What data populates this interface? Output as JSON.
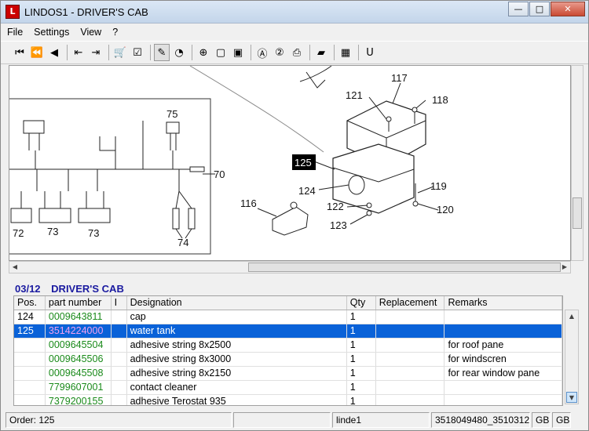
{
  "window": {
    "title": "LINDOS1 - DRIVER'S CAB",
    "app_icon_label": "L",
    "minimize": "—",
    "maximize": "□",
    "close": "✕"
  },
  "menu": [
    "File",
    "Settings",
    "View",
    "?"
  ],
  "toolbar": [
    {
      "name": "first-icon",
      "glyph": "⏮"
    },
    {
      "name": "previous-fast-icon",
      "glyph": "⏪"
    },
    {
      "name": "previous-icon",
      "glyph": "◀"
    },
    {
      "name": "sep"
    },
    {
      "name": "back-page-icon",
      "glyph": "⇤"
    },
    {
      "name": "forward-page-icon",
      "glyph": "⇥"
    },
    {
      "name": "sep"
    },
    {
      "name": "cart-icon",
      "glyph": "🛒"
    },
    {
      "name": "checklist-icon",
      "glyph": "☑"
    },
    {
      "name": "sep"
    },
    {
      "name": "link-tool-icon",
      "glyph": "✎",
      "pressed": true
    },
    {
      "name": "globe-icon",
      "glyph": "◔"
    },
    {
      "name": "sep"
    },
    {
      "name": "zoom-in-icon",
      "glyph": "⊕"
    },
    {
      "name": "page-icon",
      "glyph": "▢"
    },
    {
      "name": "page-view-icon",
      "glyph": "▣"
    },
    {
      "name": "sep"
    },
    {
      "name": "find-a-icon",
      "glyph": "Ⓐ"
    },
    {
      "name": "find-2-icon",
      "glyph": "②"
    },
    {
      "name": "print-icon",
      "glyph": "⎙"
    },
    {
      "name": "sep"
    },
    {
      "name": "book-icon",
      "glyph": "▰"
    },
    {
      "name": "sep"
    },
    {
      "name": "grid-icon",
      "glyph": "▦"
    },
    {
      "name": "sep"
    },
    {
      "name": "u-icon",
      "glyph": "U"
    }
  ],
  "drawing": {
    "labels": [
      "75",
      "70",
      "72",
      "73",
      "73",
      "74",
      "117",
      "121",
      "118",
      "125",
      "124",
      "119",
      "116",
      "122",
      "120",
      "123"
    ]
  },
  "section": {
    "number": "03/12",
    "title": "DRIVER'S CAB"
  },
  "grid": {
    "columns": [
      "Pos.",
      "part number",
      "I",
      "Designation",
      "Qty",
      "Replacement",
      "Remarks"
    ],
    "rows": [
      {
        "pos": "124",
        "pn": "0009643811",
        "i": "",
        "des": "cap",
        "qty": "1",
        "rep": "",
        "rem": ""
      },
      {
        "pos": "125",
        "pn": "3514224000",
        "i": "",
        "des": "water tank",
        "qty": "1",
        "rep": "",
        "rem": "",
        "selected": true
      },
      {
        "pos": "",
        "pn": "0009645504",
        "i": "",
        "des": "adhesive string 8x2500",
        "qty": "1",
        "rep": "",
        "rem": "for roof pane"
      },
      {
        "pos": "",
        "pn": "0009645506",
        "i": "",
        "des": "adhesive string 8x3000",
        "qty": "1",
        "rep": "",
        "rem": "for windscren"
      },
      {
        "pos": "",
        "pn": "0009645508",
        "i": "",
        "des": "adhesive string 8x2150",
        "qty": "1",
        "rep": "",
        "rem": "for rear window pane"
      },
      {
        "pos": "",
        "pn": "7799607001",
        "i": "",
        "des": "contact cleaner",
        "qty": "1",
        "rep": "",
        "rem": ""
      },
      {
        "pos": "",
        "pn": "7379200155",
        "i": "",
        "des": "adhesive Terostat 935",
        "qty": "1",
        "rep": "",
        "rem": ""
      }
    ]
  },
  "status": {
    "order": "Order: 125",
    "user": "linde1",
    "ids": "3518049480_3510312",
    "lang1": "GB",
    "lang2": "GB"
  }
}
